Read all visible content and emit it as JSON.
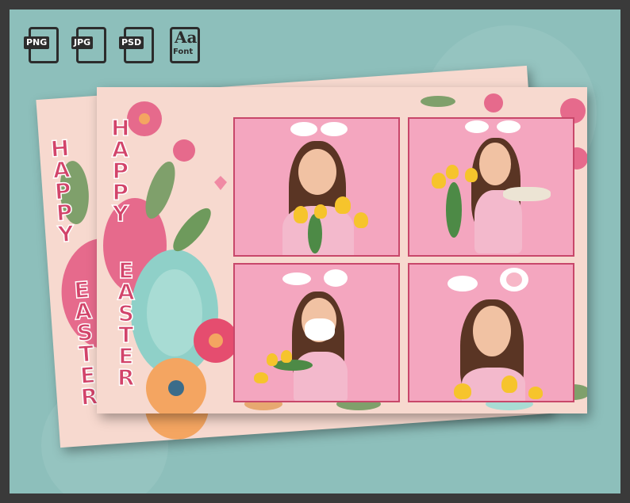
{
  "format_badges": [
    {
      "label": "PNG",
      "icon": "png-file-icon"
    },
    {
      "label": "JPG",
      "icon": "jpg-file-icon"
    },
    {
      "label": "PSD",
      "icon": "psd-file-icon"
    }
  ],
  "font_badge": {
    "glyph": "Aa",
    "label": "Font",
    "icon": "font-file-icon"
  },
  "card": {
    "word_happy": [
      "H",
      "A",
      "P",
      "P",
      "Y"
    ],
    "word_easter": [
      "E",
      "A",
      "S",
      "T",
      "E",
      "R"
    ]
  },
  "colors": {
    "background": "#8dbfbb",
    "card": "#f7d9cf",
    "title_pink": "#d2446a",
    "photo_bg": "#f4a6bf",
    "photo_border": "#c8476a"
  }
}
